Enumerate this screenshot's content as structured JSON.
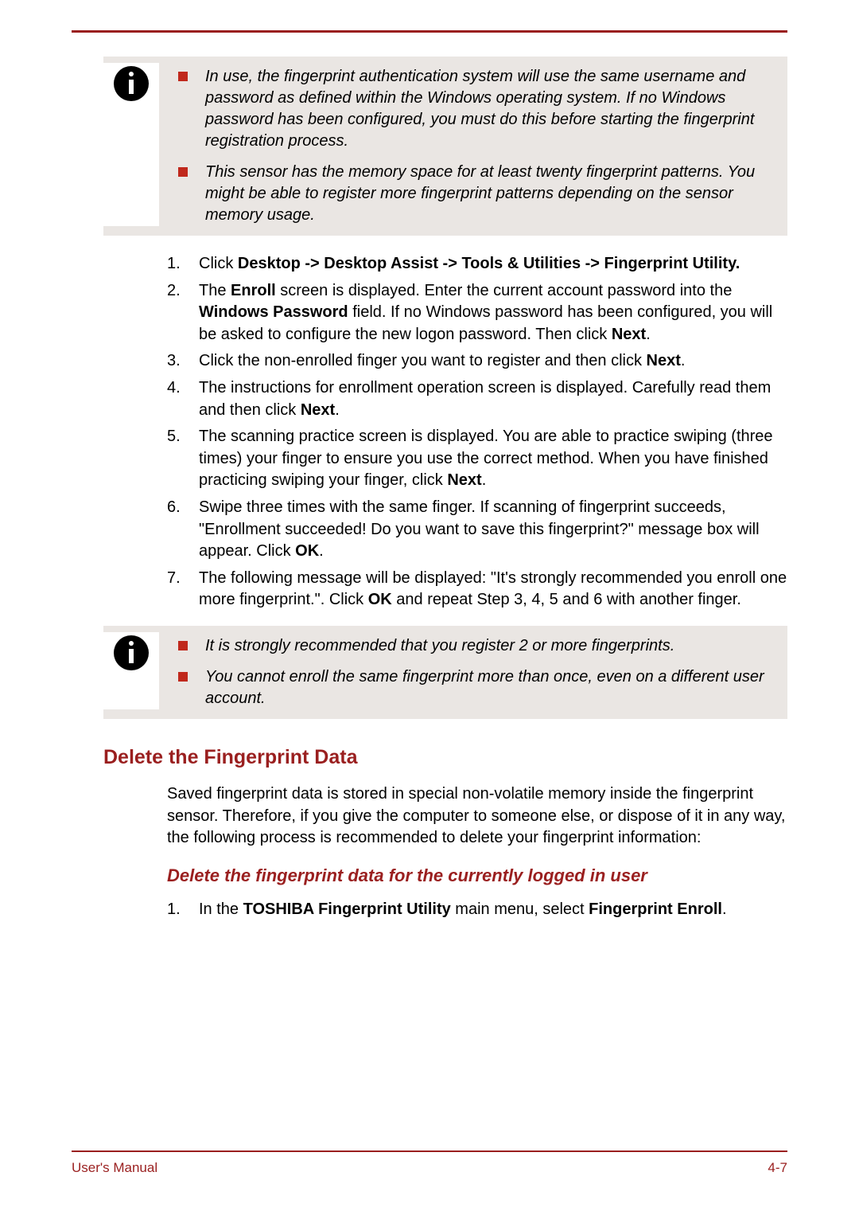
{
  "info1": {
    "items": [
      "In use, the fingerprint authentication system will use the same username and password as defined within the Windows operating system. If no Windows password has been configured, you must do this before starting the fingerprint registration process.",
      "This sensor has the memory space for at least twenty fingerprint patterns. You might be able to register more fingerprint patterns depending on the sensor memory usage."
    ]
  },
  "steps1": [
    {
      "num": "1.",
      "pre": "Click ",
      "bold1": "Desktop -> Desktop Assist -> Tools & Utilities -> Fingerprint Utility.",
      "post": ""
    },
    {
      "num": "2.",
      "parts": [
        "The ",
        {
          "b": "Enroll"
        },
        " screen is displayed. Enter the current account password into the ",
        {
          "b": "Windows Password"
        },
        " field. If no Windows password has been configured, you will be asked to configure the new logon password. Then click ",
        {
          "b": "Next"
        },
        "."
      ]
    },
    {
      "num": "3.",
      "parts": [
        "Click the non-enrolled finger you want to register and then click ",
        {
          "b": "Next"
        },
        "."
      ]
    },
    {
      "num": "4.",
      "parts": [
        "The instructions for enrollment operation screen is displayed. Carefully read them and then click ",
        {
          "b": "Next"
        },
        "."
      ]
    },
    {
      "num": "5.",
      "parts": [
        "The scanning practice screen is displayed. You are able to practice swiping (three times) your finger to ensure you use the correct method. When you have finished practicing swiping your finger, click ",
        {
          "b": "Next"
        },
        "."
      ]
    },
    {
      "num": "6.",
      "parts": [
        "Swipe three times with the same finger. If scanning of fingerprint succeeds, \"Enrollment succeeded! Do you want to save this fingerprint?\" message box will appear. Click ",
        {
          "b": "OK"
        },
        "."
      ]
    },
    {
      "num": "7.",
      "parts": [
        "The following message will be displayed: \"It's strongly recommended you enroll one more fingerprint.\". Click ",
        {
          "b": "OK"
        },
        " and repeat Step 3, 4, 5 and 6 with another finger."
      ]
    }
  ],
  "info2": {
    "items": [
      "It is strongly recommended that you register 2 or more fingerprints.",
      "You cannot enroll the same fingerprint more than once, even on a different user account."
    ]
  },
  "h2": "Delete the Fingerprint Data",
  "para1": "Saved fingerprint data is stored in special non-volatile memory inside the fingerprint sensor. Therefore, if you give the computer to someone else, or dispose of it in any way, the following process is recommended to delete your fingerprint information:",
  "h3": "Delete the fingerprint data for the currently logged in user",
  "steps2": [
    {
      "num": "1.",
      "parts": [
        "In the ",
        {
          "b": "TOSHIBA Fingerprint Utility"
        },
        " main menu, select ",
        {
          "b": "Fingerprint Enroll"
        },
        "."
      ]
    }
  ],
  "footer": {
    "left": "User's Manual",
    "right": "4-7"
  }
}
